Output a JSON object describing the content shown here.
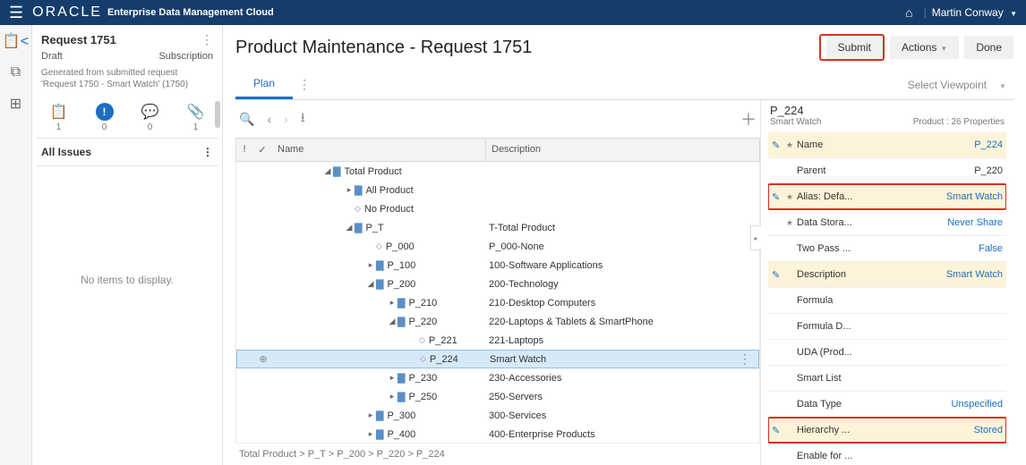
{
  "topbar": {
    "brand": "ORACLE",
    "appname": "Enterprise Data Management Cloud",
    "user": "Martin Conway"
  },
  "request": {
    "title": "Request 1751",
    "status": "Draft",
    "type": "Subscription",
    "desc": "Generated from submitted request 'Request 1750 - Smart Watch' (1750)",
    "counts": {
      "clipboard": "1",
      "issues": "0",
      "comments": "0",
      "attachments": "1"
    }
  },
  "issues": {
    "header": "All Issues",
    "empty": "No items to display."
  },
  "main": {
    "title": "Product Maintenance - Request 1751",
    "buttons": {
      "submit": "Submit",
      "actions": "Actions",
      "done": "Done"
    },
    "tab": "Plan",
    "viewpoint": "Select Viewpoint"
  },
  "grid": {
    "cols": {
      "name": "Name",
      "desc": "Description"
    },
    "rows": [
      {
        "indent": 0,
        "exp": "◢",
        "icon": "folder",
        "name": "Total Product",
        "desc": ""
      },
      {
        "indent": 1,
        "exp": "▸",
        "icon": "folder",
        "name": "All Product",
        "desc": ""
      },
      {
        "indent": 1,
        "exp": "",
        "icon": "diamond",
        "name": "No Product",
        "desc": ""
      },
      {
        "indent": 1,
        "exp": "◢",
        "icon": "folder",
        "name": "P_T",
        "desc": "T-Total Product"
      },
      {
        "indent": 2,
        "exp": "",
        "icon": "diamond",
        "name": "P_000",
        "desc": "P_000-None"
      },
      {
        "indent": 2,
        "exp": "▸",
        "icon": "folder",
        "name": "P_100",
        "desc": "100-Software Applications"
      },
      {
        "indent": 2,
        "exp": "◢",
        "icon": "folder",
        "name": "P_200",
        "desc": "200-Technology"
      },
      {
        "indent": 3,
        "exp": "▸",
        "icon": "folder",
        "name": "P_210",
        "desc": "210-Desktop Computers"
      },
      {
        "indent": 3,
        "exp": "◢",
        "icon": "folder",
        "name": "P_220",
        "desc": "220-Laptops & Tablets & SmartPhone"
      },
      {
        "indent": 4,
        "exp": "",
        "icon": "diamond",
        "name": "P_221",
        "desc": "221-Laptops"
      },
      {
        "indent": 4,
        "exp": "",
        "icon": "diamond",
        "name": "P_224",
        "desc": "Smart Watch",
        "selected": true,
        "plus": true,
        "kebab": true
      },
      {
        "indent": 3,
        "exp": "▸",
        "icon": "folder",
        "name": "P_230",
        "desc": "230-Accessories"
      },
      {
        "indent": 3,
        "exp": "▸",
        "icon": "folder",
        "name": "P_250",
        "desc": "250-Servers"
      },
      {
        "indent": 2,
        "exp": "▸",
        "icon": "folder",
        "name": "P_300",
        "desc": "300-Services"
      },
      {
        "indent": 2,
        "exp": "▸",
        "icon": "folder",
        "name": "P_400",
        "desc": "400-Enterprise Products"
      }
    ],
    "breadcrumb": "Total Product > P_T > P_200 > P_220 > P_224"
  },
  "props": {
    "id": "P_224",
    "sub": "Smart Watch",
    "meta": "Product : 26 Properties",
    "rows": [
      {
        "pencil": true,
        "star": true,
        "label": "Name",
        "value": "P_224",
        "link": true,
        "hl": true
      },
      {
        "pencil": false,
        "star": false,
        "label": "Parent",
        "value": "P_220",
        "link": false,
        "hl": false
      },
      {
        "pencil": true,
        "star": true,
        "label": "Alias: Defa...",
        "value": "Smart Watch",
        "link": true,
        "hl": true,
        "red": true
      },
      {
        "pencil": false,
        "star": true,
        "label": "Data Stora...",
        "value": "Never Share",
        "link": true,
        "hl": false
      },
      {
        "pencil": false,
        "star": false,
        "label": "Two Pass ...",
        "value": "False",
        "link": true,
        "hl": false
      },
      {
        "pencil": true,
        "star": false,
        "label": "Description",
        "value": "Smart Watch",
        "link": true,
        "hl": true
      },
      {
        "pencil": false,
        "star": false,
        "label": "Formula",
        "value": "",
        "link": false,
        "hl": false
      },
      {
        "pencil": false,
        "star": false,
        "label": "Formula D...",
        "value": "",
        "link": false,
        "hl": false
      },
      {
        "pencil": false,
        "star": false,
        "label": "UDA (Prod...",
        "value": "",
        "link": false,
        "hl": false
      },
      {
        "pencil": false,
        "star": false,
        "label": "Smart List",
        "value": "",
        "link": false,
        "hl": false
      },
      {
        "pencil": false,
        "star": false,
        "label": "Data Type",
        "value": "Unspecified",
        "link": true,
        "hl": false
      },
      {
        "pencil": true,
        "star": false,
        "label": "Hierarchy ...",
        "value": "Stored",
        "link": true,
        "hl": true,
        "red": true
      },
      {
        "pencil": false,
        "star": false,
        "label": "Enable for ...",
        "value": "",
        "link": false,
        "hl": false
      }
    ]
  }
}
